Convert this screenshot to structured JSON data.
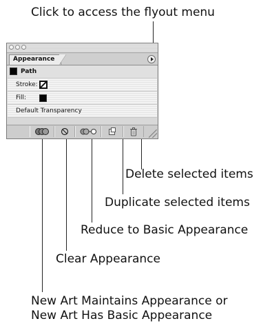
{
  "callouts": {
    "flyout": "Click to access the flyout menu",
    "delete": "Delete selected items",
    "duplicate": "Duplicate selected items",
    "reduce": "Reduce to Basic Appearance",
    "clear": "Clear Appearance",
    "new_art_line1": "New Art Maintains Appearance or",
    "new_art_line2": "New Art Has Basic Appearance"
  },
  "panel": {
    "tab_label": "Appearance",
    "rows": {
      "path": "Path",
      "stroke": "Stroke:",
      "fill": "Fill:",
      "transparency": "Default Transparency"
    }
  },
  "icons": {
    "flyout": "flyout-menu-arrow-icon",
    "new_art": "new-art-appearance-icon",
    "clear": "clear-appearance-icon",
    "reduce": "reduce-to-basic-icon",
    "duplicate": "duplicate-item-icon",
    "delete": "trash-icon"
  },
  "colors": {
    "fill_swatch": "#050505",
    "panel_bg": "#d8d8d8"
  }
}
